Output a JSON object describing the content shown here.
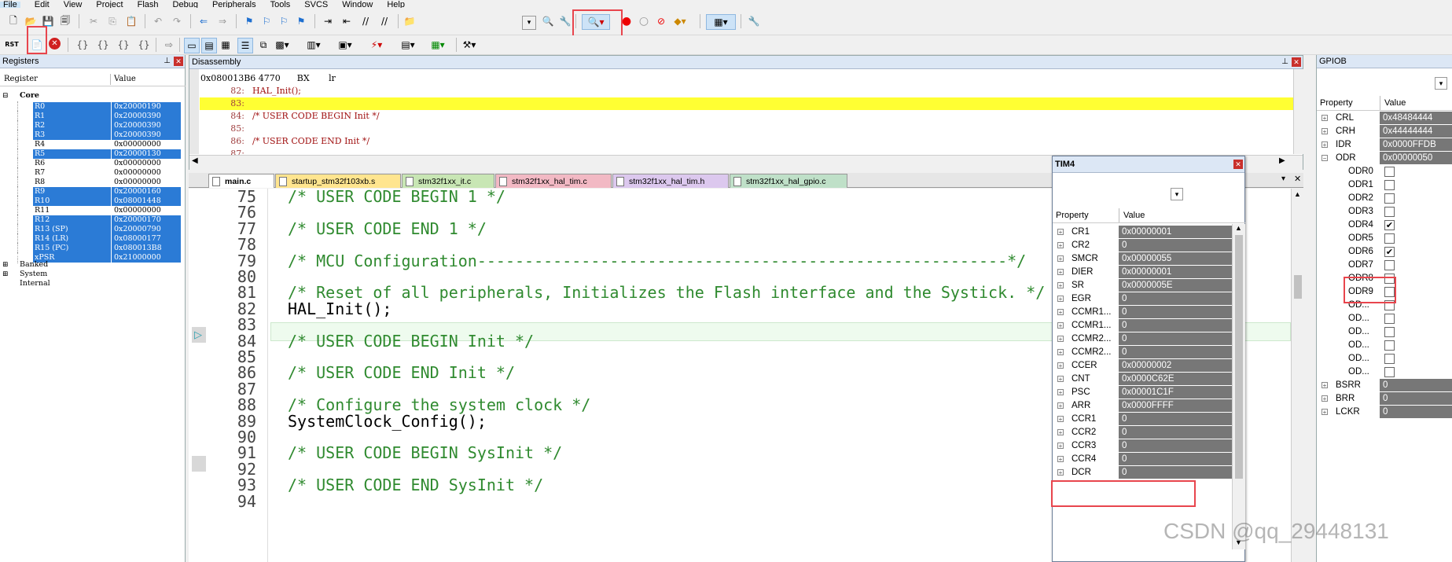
{
  "menu": [
    "File",
    "Edit",
    "View",
    "Project",
    "Flash",
    "Debug",
    "Peripherals",
    "Tools",
    "SVCS",
    "Window",
    "Help"
  ],
  "toolbar": {
    "rst_label": "RST"
  },
  "registers": {
    "title": "Registers",
    "col_register": "Register",
    "col_value": "Value",
    "core_label": "Core",
    "rows": [
      {
        "name": "R0",
        "value": "0x20000190",
        "sel": true
      },
      {
        "name": "R1",
        "value": "0x20000390",
        "sel": true
      },
      {
        "name": "R2",
        "value": "0x20000390",
        "sel": true
      },
      {
        "name": "R3",
        "value": "0x20000390",
        "sel": true
      },
      {
        "name": "R4",
        "value": "0x00000000",
        "sel": false
      },
      {
        "name": "R5",
        "value": "0x20000130",
        "sel": true
      },
      {
        "name": "R6",
        "value": "0x00000000",
        "sel": false
      },
      {
        "name": "R7",
        "value": "0x00000000",
        "sel": false
      },
      {
        "name": "R8",
        "value": "0x00000000",
        "sel": false
      },
      {
        "name": "R9",
        "value": "0x20000160",
        "sel": true
      },
      {
        "name": "R10",
        "value": "0x08001448",
        "sel": true
      },
      {
        "name": "R11",
        "value": "0x00000000",
        "sel": false
      },
      {
        "name": "R12",
        "value": "0x20000170",
        "sel": true
      },
      {
        "name": "R13 (SP)",
        "value": "0x20000790",
        "sel": true
      },
      {
        "name": "R14 (LR)",
        "value": "0x08000177",
        "sel": true
      },
      {
        "name": "R15 (PC)",
        "value": "0x080013B8",
        "sel": true
      },
      {
        "name": "xPSR",
        "value": "0x21000000",
        "sel": true
      }
    ],
    "groups": [
      "Banked",
      "System",
      "Internal"
    ]
  },
  "disassembly": {
    "title": "Disassembly",
    "lines": [
      {
        "num": "",
        "text": "0x080013B6 4770      BX       lr"
      },
      {
        "num": "82:",
        "text": "HAL_Init();"
      },
      {
        "num": "83:",
        "text": ""
      },
      {
        "num": "84:",
        "text": "/* USER CODE BEGIN Init */"
      },
      {
        "num": "85:",
        "text": ""
      },
      {
        "num": "86:",
        "text": "/* USER CODE END Init */"
      },
      {
        "num": "87:",
        "text": ""
      }
    ]
  },
  "tabs": [
    "main.c",
    "startup_stm32f103xb.s",
    "stm32f1xx_it.c",
    "stm32f1xx_hal_tim.c",
    "stm32f1xx_hal_tim.h",
    "stm32f1xx_hal_gpio.c"
  ],
  "editor": {
    "lines": [
      {
        "n": "75",
        "t": "/* USER CODE BEGIN 1 */",
        "c": true
      },
      {
        "n": "76",
        "t": "",
        "c": false
      },
      {
        "n": "77",
        "t": "/* USER CODE END 1 */",
        "c": true
      },
      {
        "n": "78",
        "t": "",
        "c": false
      },
      {
        "n": "79",
        "t": "/* MCU Configuration--------------------------------------------------------*/",
        "c": true
      },
      {
        "n": "80",
        "t": "",
        "c": false
      },
      {
        "n": "81",
        "t": "/* Reset of all peripherals, Initializes the Flash interface and the Systick. */",
        "c": true
      },
      {
        "n": "82",
        "t": "HAL_Init();",
        "c": false
      },
      {
        "n": "83",
        "t": "",
        "c": false
      },
      {
        "n": "84",
        "t": "/* USER CODE BEGIN Init */",
        "c": true
      },
      {
        "n": "85",
        "t": "",
        "c": false
      },
      {
        "n": "86",
        "t": "/* USER CODE END Init */",
        "c": true
      },
      {
        "n": "87",
        "t": "",
        "c": false
      },
      {
        "n": "88",
        "t": "/* Configure the system clock */",
        "c": true
      },
      {
        "n": "89",
        "t": "SystemClock_Config();",
        "c": false
      },
      {
        "n": "90",
        "t": "",
        "c": false
      },
      {
        "n": "91",
        "t": "/* USER CODE BEGIN SysInit */",
        "c": true
      },
      {
        "n": "92",
        "t": "",
        "c": false
      },
      {
        "n": "93",
        "t": "/* USER CODE END SysInit */",
        "c": true
      },
      {
        "n": "94",
        "t": "",
        "c": false
      }
    ]
  },
  "tim4": {
    "title": "TIM4",
    "col_property": "Property",
    "col_value": "Value",
    "rows": [
      {
        "name": "CR1",
        "value": "0x00000001"
      },
      {
        "name": "CR2",
        "value": "0"
      },
      {
        "name": "SMCR",
        "value": "0x00000055"
      },
      {
        "name": "DIER",
        "value": "0x00000001"
      },
      {
        "name": "SR",
        "value": "0x0000005E"
      },
      {
        "name": "EGR",
        "value": "0"
      },
      {
        "name": "CCMR1...",
        "value": "0"
      },
      {
        "name": "CCMR1...",
        "value": "0"
      },
      {
        "name": "CCMR2...",
        "value": "0"
      },
      {
        "name": "CCMR2...",
        "value": "0"
      },
      {
        "name": "CCER",
        "value": "0x00000002"
      },
      {
        "name": "CNT",
        "value": "0x0000C62E"
      },
      {
        "name": "PSC",
        "value": "0x00001C1F"
      },
      {
        "name": "ARR",
        "value": "0x0000FFFF"
      },
      {
        "name": "CCR1",
        "value": "0"
      },
      {
        "name": "CCR2",
        "value": "0"
      },
      {
        "name": "CCR3",
        "value": "0"
      },
      {
        "name": "CCR4",
        "value": "0"
      },
      {
        "name": "DCR",
        "value": "0"
      }
    ]
  },
  "gpiob": {
    "title": "GPIOB",
    "col_property": "Property",
    "col_value": "Value",
    "regs": [
      {
        "name": "CRL",
        "value": "0x48484444"
      },
      {
        "name": "CRH",
        "value": "0x44444444"
      },
      {
        "name": "IDR",
        "value": "0x0000FFDB"
      },
      {
        "name": "ODR",
        "value": "0x00000050"
      }
    ],
    "bits": [
      {
        "name": "ODR0",
        "checked": false
      },
      {
        "name": "ODR1",
        "checked": false
      },
      {
        "name": "ODR2",
        "checked": false
      },
      {
        "name": "ODR3",
        "checked": false
      },
      {
        "name": "ODR4",
        "checked": true
      },
      {
        "name": "ODR5",
        "checked": false
      },
      {
        "name": "ODR6",
        "checked": true
      },
      {
        "name": "ODR7",
        "checked": false
      },
      {
        "name": "ODR8",
        "checked": false
      },
      {
        "name": "ODR9",
        "checked": false
      },
      {
        "name": "OD...",
        "checked": false
      },
      {
        "name": "OD...",
        "checked": false
      },
      {
        "name": "OD...",
        "checked": false
      },
      {
        "name": "OD...",
        "checked": false
      },
      {
        "name": "OD...",
        "checked": false
      },
      {
        "name": "OD...",
        "checked": false
      }
    ],
    "tail": [
      {
        "name": "BSRR",
        "value": "0"
      },
      {
        "name": "BRR",
        "value": "0"
      },
      {
        "name": "LCKR",
        "value": "0"
      }
    ]
  },
  "watermark": "CSDN @qq_29448131"
}
